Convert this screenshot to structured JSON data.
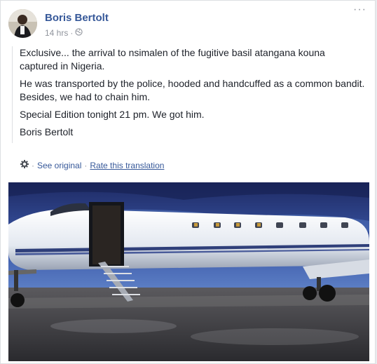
{
  "post": {
    "author": "Boris Bertolt",
    "timestamp": "14 hrs",
    "separator": "·",
    "more_label": "···",
    "paragraphs": [
      "Exclusive... the arrival to nsimalen of the fugitive basil atangana kouna captured in Nigeria.",
      "He was transported by the police, hooded and handcuffed as a common bandit. Besides, we had to chain him.",
      "Special Edition tonight 21 pm. We got him.",
      "Boris Bertolt"
    ],
    "translation": {
      "see_original": "See original",
      "rate": "Rate this translation",
      "sep": "·"
    }
  },
  "colors": {
    "link": "#365899",
    "meta": "#90949c",
    "text": "#1d2129"
  },
  "icons": {
    "privacy": "globe-icon",
    "translate": "gear-icon",
    "more": "more-options-icon"
  }
}
